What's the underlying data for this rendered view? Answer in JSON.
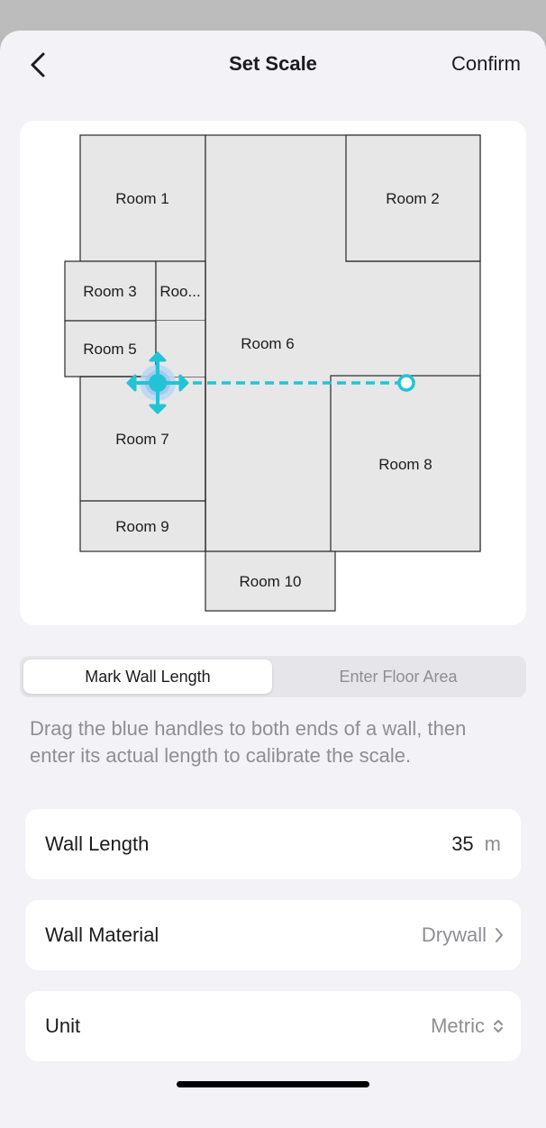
{
  "header": {
    "title": "Set Scale",
    "confirm_label": "Confirm"
  },
  "floor_plan": {
    "rooms": [
      "Room 1",
      "Room 2",
      "Room 3",
      "Roo...",
      "Room 5",
      "Room 6",
      "Room 7",
      "Room 8",
      "Room 9",
      "Room 10"
    ]
  },
  "tabs": {
    "active": "Mark Wall Length",
    "inactive": "Enter Floor Area"
  },
  "instructions": "Drag the blue handles to both ends of a wall, then enter its actual length to calibrate the scale.",
  "settings": {
    "wall_length": {
      "label": "Wall Length",
      "value": "35",
      "unit": "m"
    },
    "wall_material": {
      "label": "Wall Material",
      "value": "Drywall"
    },
    "unit": {
      "label": "Unit",
      "value": "Metric"
    }
  },
  "colors": {
    "accent": "#23c3d6",
    "room_fill": "#e6e7e6",
    "sheet_bg": "#f2f2f7",
    "secondary_text": "#8e8e93"
  }
}
